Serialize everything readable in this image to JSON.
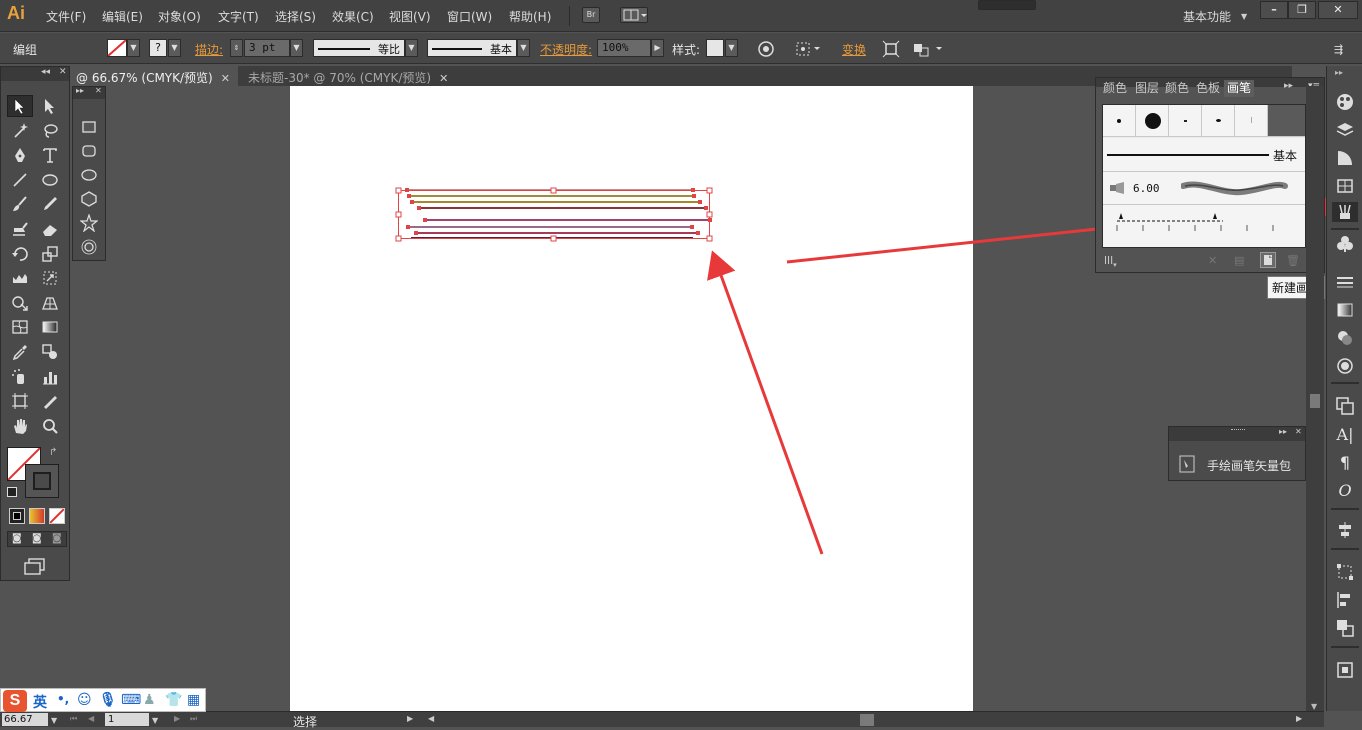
{
  "app": {
    "logo": "Ai"
  },
  "menu": {
    "items": [
      "文件(F)",
      "编辑(E)",
      "对象(O)",
      "文字(T)",
      "选择(S)",
      "效果(C)",
      "视图(V)",
      "窗口(W)",
      "帮助(H)"
    ],
    "bridge_label": "Br",
    "workspace": "基本功能"
  },
  "control_bar": {
    "selection_type": "编组",
    "stroke_label": "描边:",
    "stroke_weight": "3 pt",
    "stroke_profile": "等比",
    "brush_style": "基本",
    "opacity_label": "不透明度:",
    "opacity_value": "100%",
    "style_label": "样式:",
    "transform_label": "变换"
  },
  "document_tabs": [
    {
      "label": "@ 66.67% (CMYK/预览)",
      "active": true
    },
    {
      "label": "未标题-30* @ 70% (CMYK/预览)",
      "active": false
    }
  ],
  "tools": {
    "names": [
      "selection",
      "direct-selection",
      "magic-wand",
      "lasso",
      "pen",
      "type",
      "line-segment",
      "ellipse",
      "paintbrush",
      "pencil",
      "blob-brush",
      "eraser",
      "rotate",
      "scale",
      "warp",
      "free-transform",
      "shape-builder",
      "perspective-grid",
      "mesh",
      "gradient",
      "eyedropper",
      "blend",
      "symbol-sprayer",
      "column-graph",
      "artboard",
      "slice",
      "hand",
      "zoom"
    ]
  },
  "brush_panel": {
    "tabs": [
      "颜色",
      "图层",
      "颜色",
      "色板",
      "画笔"
    ],
    "active_tab": "画笔",
    "basic_label": "基本",
    "brush_size": "6.00",
    "tooltip": "新建画笔"
  },
  "library_panel": {
    "item": "手绘画笔矢量包"
  },
  "ime": {
    "mode": "英",
    "punct": "•,"
  },
  "status": {
    "zoom": "66.67",
    "page": "1",
    "tool": "选择"
  },
  "colors": {
    "accent": "#e79a3a",
    "arrow": "#e8393a",
    "selection": "#e04545"
  }
}
